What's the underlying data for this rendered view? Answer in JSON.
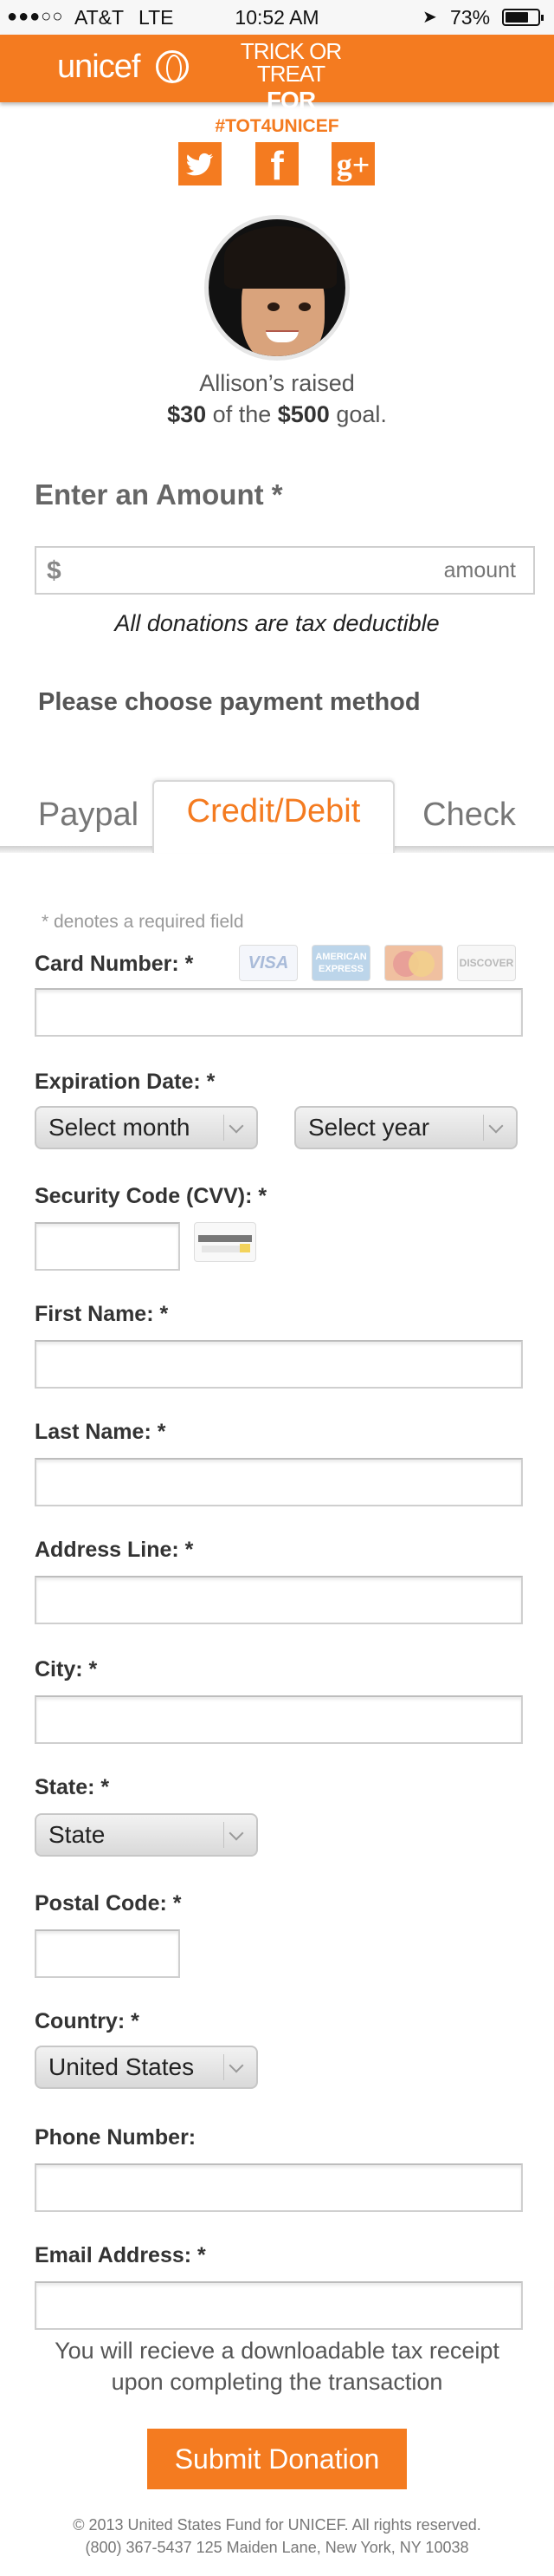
{
  "status_bar": {
    "signal": "●●●○○",
    "carrier": "AT&T",
    "network": "LTE",
    "time": "10:52 AM",
    "battery_text": "73%",
    "battery_level": 0.73
  },
  "header": {
    "logo_text": "unicef",
    "campaign_line1": "TRICK OR TREAT",
    "campaign_line2": "FOR UNICEF"
  },
  "hashtag": "#TOT4UNICEF",
  "social": {
    "facebook_glyph": "f",
    "googleplus_glyph": "g+"
  },
  "fundraiser": {
    "raised_line": "Allison’s raised",
    "amount_raised": "$30",
    "of_the": "of the",
    "goal_amount": "$500",
    "goal_suffix": "goal."
  },
  "amount": {
    "title": "Enter an Amount *",
    "currency": "$",
    "placeholder": "amount",
    "tax_note": "All donations are tax deductible"
  },
  "payment": {
    "title": "Please choose payment method",
    "tabs": [
      "Paypal",
      "Credit/Debit",
      "Check"
    ],
    "active_tab": "Credit/Debit"
  },
  "form": {
    "required_note": "* denotes a required field",
    "card_number_label": "Card Number: *",
    "cards": {
      "visa": "VISA",
      "amex_line1": "AMERICAN",
      "amex_line2": "EXPRESS",
      "discover": "DISCOVER"
    },
    "expiration_label": "Expiration Date: *",
    "month_select": "Select month",
    "year_select": "Select year",
    "cvv_label": "Security Code (CVV): *",
    "first_name_label": "First Name: *",
    "last_name_label": "Last Name: *",
    "address_label": "Address Line: *",
    "city_label": "City: *",
    "state_label": "State: *",
    "state_select": "State",
    "postal_label": "Postal Code: *",
    "country_label": "Country: *",
    "country_select": "United States",
    "phone_label": "Phone Number:",
    "email_label": "Email Address: *"
  },
  "receipt_note_line1": "You will recieve a downloadable tax receipt",
  "receipt_note_line2": "upon completing the transaction",
  "submit_label": "Submit Donation",
  "footer": {
    "line1": "© 2013 United States Fund for UNICEF. All rights reserved.",
    "line2": "(800) 367-5437 125 Maiden Lane, New York, NY 10038"
  },
  "colors": {
    "brand_orange": "#f47b20"
  }
}
